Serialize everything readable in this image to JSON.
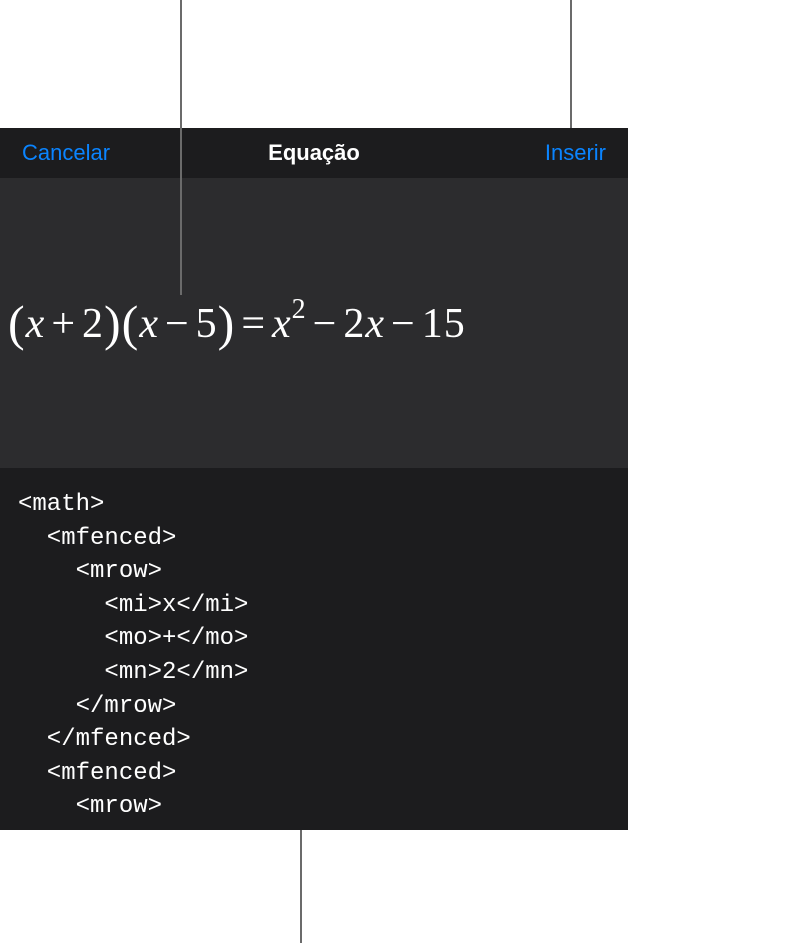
{
  "header": {
    "cancel_label": "Cancelar",
    "title": "Equação",
    "insert_label": "Inserir"
  },
  "equation": {
    "parts": {
      "lparen1": "(",
      "x1": "x",
      "plus": "+",
      "two": "2",
      "rparen1": ")",
      "lparen2": "(",
      "x2": "x",
      "minus1": "−",
      "five": "5",
      "rparen2": ")",
      "equals": "=",
      "x3": "x",
      "sup2": "2",
      "minus2": "−",
      "two_b": "2",
      "x4": "x",
      "minus3": "−",
      "fifteen": "15"
    }
  },
  "code": {
    "lines": "<math>\n  <mfenced>\n    <mrow>\n      <mi>x</mi>\n      <mo>+</mo>\n      <mn>2</mn>\n    </mrow>\n  </mfenced>\n  <mfenced>\n    <mrow>"
  }
}
